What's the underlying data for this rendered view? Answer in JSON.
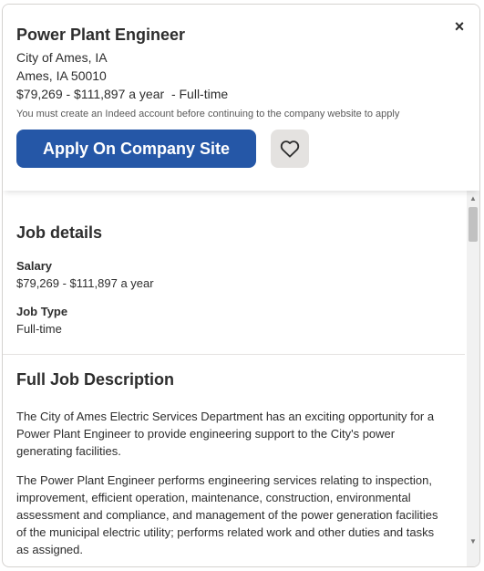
{
  "header": {
    "title": "Power Plant Engineer",
    "company": "City of Ames, IA",
    "location": "Ames, IA 50010",
    "salary_line": "$79,269 - $111,897 a year  - Full-time",
    "notice": "You must create an Indeed account before continuing to the company website to apply",
    "apply_label": "Apply On Company Site",
    "close_label": "×"
  },
  "job_details": {
    "heading": "Job details",
    "salary_label": "Salary",
    "salary_value": "$79,269 - $111,897 a year",
    "job_type_label": "Job Type",
    "job_type_value": "Full-time"
  },
  "description": {
    "heading": "Full Job Description",
    "paragraphs": [
      "The City of Ames Electric Services Department has an exciting opportunity for a Power Plant Engineer to provide engineering support to the City's power generating facilities.",
      "The Power Plant Engineer performs engineering services relating to inspection, improvement, efficient operation, maintenance, construction, environmental assessment and compliance, and management of the power generation facilities of the municipal electric utility; performs related work and other duties and tasks as assigned."
    ]
  },
  "scrollbar": {
    "up_arrow": "▲",
    "down_arrow": "▼",
    "position_fraction": 0.0
  },
  "colors": {
    "apply_button": "#2557a7",
    "save_button": "#e4e2e0",
    "text": "#2d2d2d"
  },
  "icons": {
    "save": "heart-icon",
    "close": "close-icon"
  }
}
